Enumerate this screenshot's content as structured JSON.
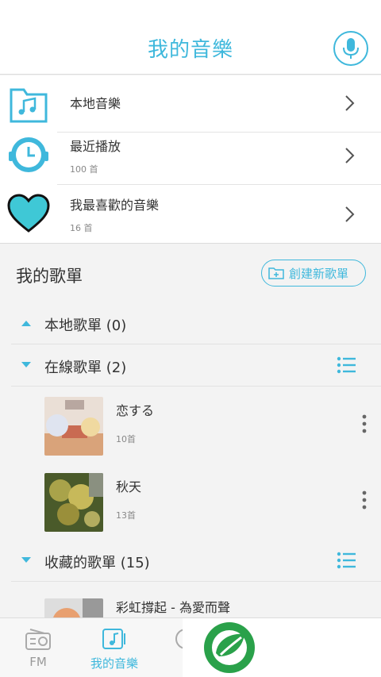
{
  "header": {
    "title": "我的音樂",
    "mic_icon": "microphone-icon"
  },
  "quick_links": [
    {
      "label": "本地音樂",
      "sub": "",
      "icon": "folder-music-icon"
    },
    {
      "label": "最近播放",
      "sub": "100 首",
      "icon": "clock-headset-icon"
    },
    {
      "label": "我最喜歡的音樂",
      "sub": "16 首",
      "icon": "heart-icon"
    }
  ],
  "playlists": {
    "title": "我的歌單",
    "create_label": "創建新歌單",
    "groups": [
      {
        "name": "本地歌單 (0)",
        "expanded": true
      },
      {
        "name": "在線歌單 (2)",
        "expanded": true
      },
      {
        "name": "收藏的歌單 (15)",
        "expanded": true
      }
    ],
    "online_songs": [
      {
        "name": "恋する",
        "count": "10首"
      },
      {
        "name": "秋天",
        "count": "13首"
      }
    ],
    "saved_songs": [
      {
        "name": "彩虹撐起 - 為愛而聲"
      }
    ]
  },
  "bottom_nav": [
    {
      "label": "FM",
      "active": false
    },
    {
      "label": "我的音樂",
      "active": true
    }
  ],
  "colors": {
    "accent": "#3fb8dc",
    "text": "#333333",
    "muted": "#888888"
  }
}
